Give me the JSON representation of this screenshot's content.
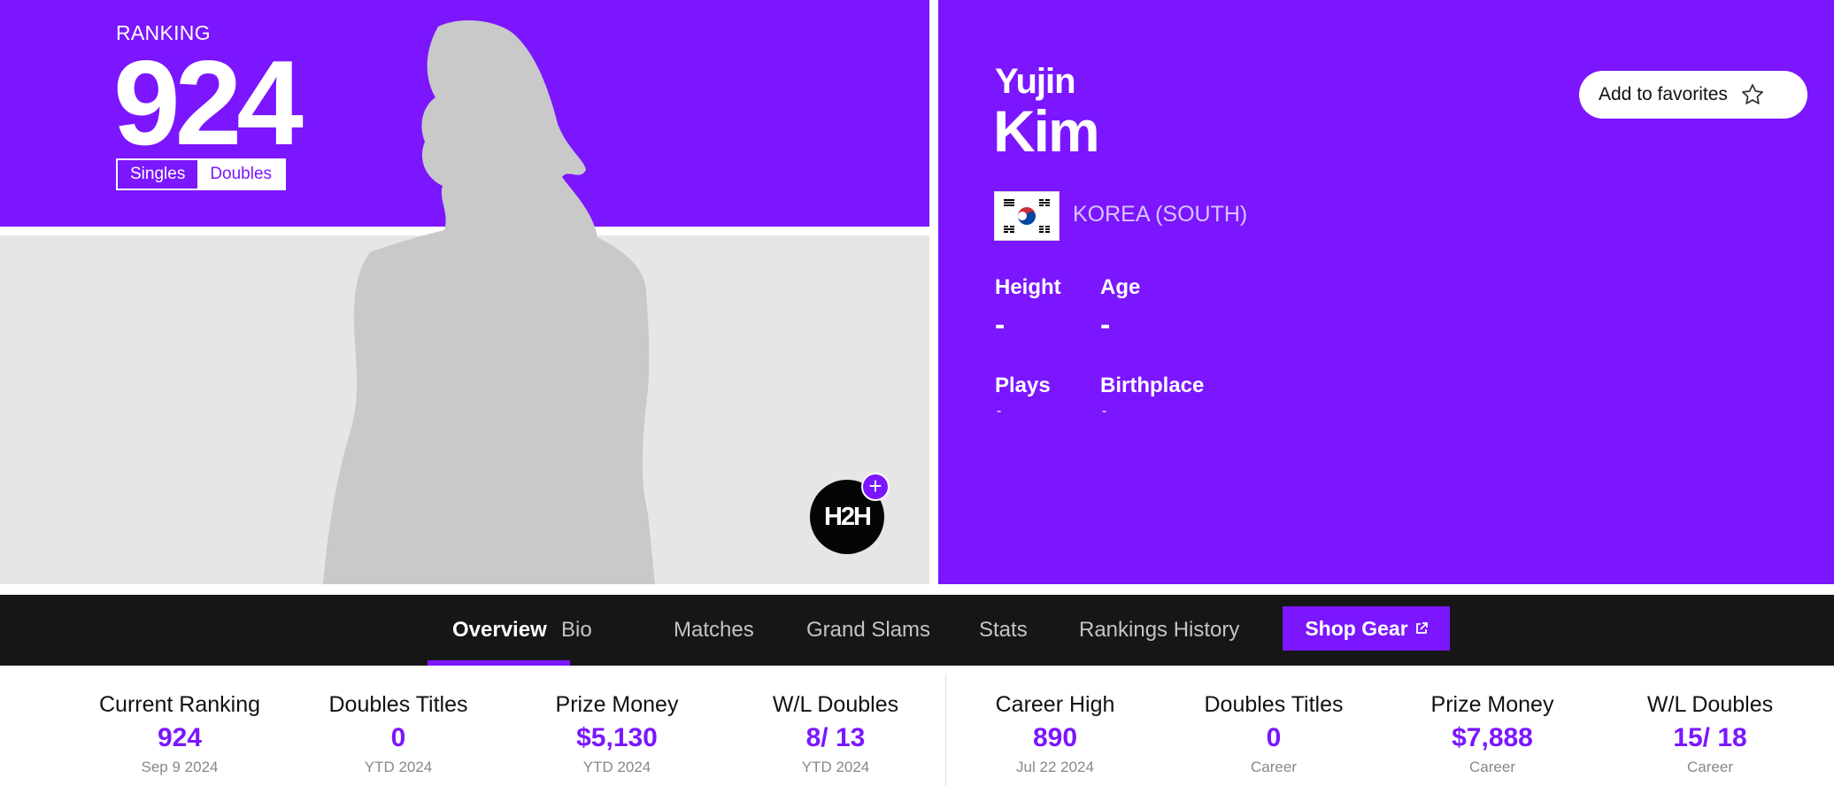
{
  "ranking": {
    "label": "RANKING",
    "value": "924",
    "toggle": {
      "singles": "Singles",
      "doubles": "Doubles",
      "selected": "Doubles"
    }
  },
  "h2h": {
    "label": "H2H",
    "plus": "+"
  },
  "player": {
    "first_name": "Yujin",
    "last_name": "Kim",
    "country": "KOREA (SOUTH)",
    "flag_icon": "south-korea-flag-icon"
  },
  "favorites": {
    "label": "Add to favorites",
    "icon": "star-icon"
  },
  "attributes": {
    "height": {
      "label": "Height",
      "value": "-"
    },
    "age": {
      "label": "Age",
      "value": "-"
    },
    "plays": {
      "label": "Plays",
      "value": "-"
    },
    "birthplace": {
      "label": "Birthplace",
      "value": "-"
    }
  },
  "nav": {
    "items": [
      "Overview",
      "Bio",
      "Matches",
      "Grand Slams",
      "Stats",
      "Rankings History"
    ],
    "active": "Overview",
    "shop": "Shop Gear",
    "shop_icon": "external-link-icon"
  },
  "stats": [
    {
      "label": "Current Ranking",
      "value": "924",
      "sub": "Sep 9 2024"
    },
    {
      "label": "Doubles Titles",
      "value": "0",
      "sub": "YTD 2024"
    },
    {
      "label": "Prize Money",
      "value": "$5,130",
      "sub": "YTD 2024"
    },
    {
      "label": "W/L Doubles",
      "value": "8/ 13",
      "sub": "YTD 2024"
    },
    {
      "label": "Career High",
      "value": "890",
      "sub": "Jul 22 2024"
    },
    {
      "label": "Doubles Titles",
      "value": "0",
      "sub": "Career"
    },
    {
      "label": "Prize Money",
      "value": "$7,888",
      "sub": "Career"
    },
    {
      "label": "W/L Doubles",
      "value": "15/ 18",
      "sub": "Career"
    }
  ],
  "colors": {
    "accent": "#7b16ff",
    "nav_bg": "#161616",
    "placeholder_bg": "#e6e6e6",
    "silhouette": "#c9c9c9"
  }
}
